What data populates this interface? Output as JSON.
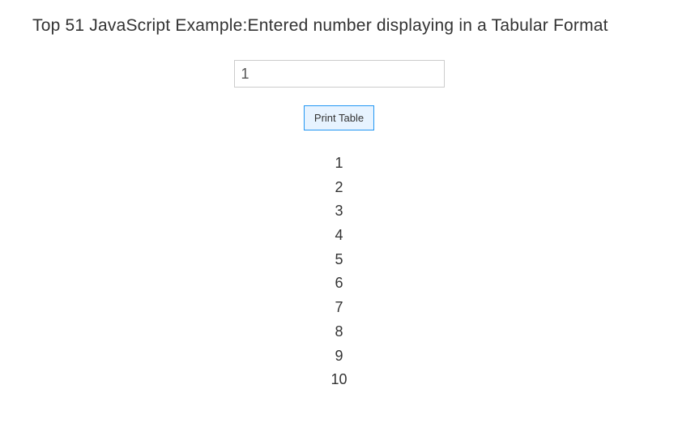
{
  "heading": "Top 51 JavaScript Example:Entered number displaying in a Tabular Format",
  "input": {
    "value": "1"
  },
  "button": {
    "label": "Print Table"
  },
  "results": [
    "1",
    "2",
    "3",
    "4",
    "5",
    "6",
    "7",
    "8",
    "9",
    "10"
  ]
}
